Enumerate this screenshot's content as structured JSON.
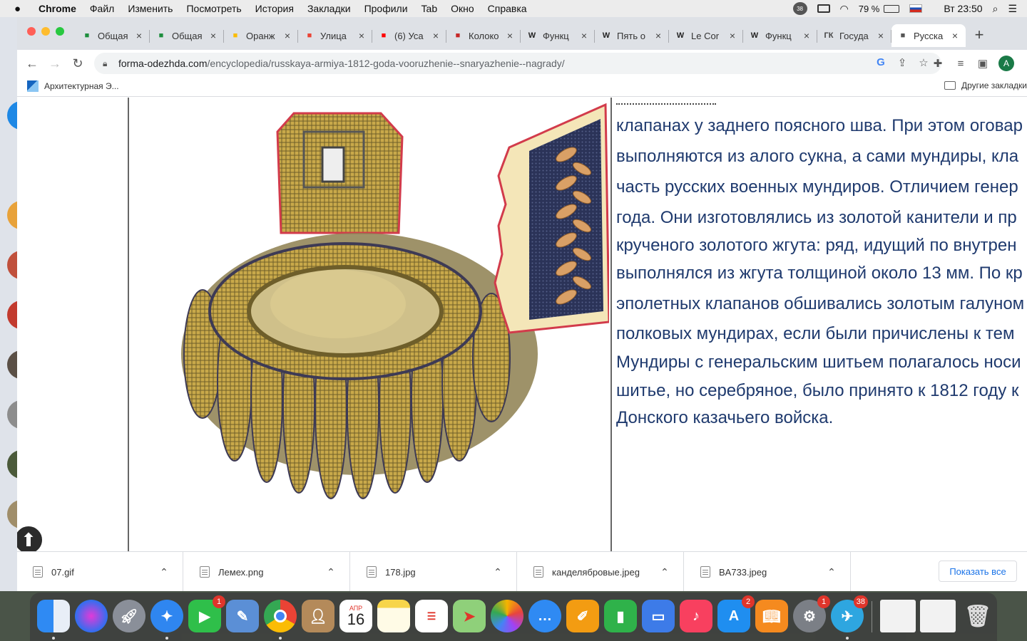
{
  "menubar": {
    "app": "Chrome",
    "items": [
      "Файл",
      "Изменить",
      "Посмотреть",
      "История",
      "Закладки",
      "Профили",
      "Tab",
      "Окно",
      "Справка"
    ],
    "battery": "79 %",
    "clock": "Вт 23:50",
    "notifications_badge": "38"
  },
  "tabs": [
    {
      "title": "Общая",
      "icon": "sheets-icon",
      "color": "#1e8e3e"
    },
    {
      "title": "Общая",
      "icon": "sheets-icon",
      "color": "#1e8e3e"
    },
    {
      "title": "Оранж",
      "icon": "drive-icon",
      "color": "#fbbc04"
    },
    {
      "title": "Улица",
      "icon": "maps-pin-icon",
      "color": "#ea4335"
    },
    {
      "title": "(6) Уса",
      "icon": "youtube-icon",
      "color": "#ff0000"
    },
    {
      "title": "Колоко",
      "icon": "star-icon",
      "color": "#c62828"
    },
    {
      "title": "Функц",
      "icon": "wikipedia-icon",
      "color": "#222222"
    },
    {
      "title": "Пять о",
      "icon": "wikipedia-icon",
      "color": "#222222"
    },
    {
      "title": "Le Cor",
      "icon": "wikipedia-icon",
      "color": "#222222"
    },
    {
      "title": "Функц",
      "icon": "wikipedia-icon",
      "color": "#222222"
    },
    {
      "title": "Госуда",
      "icon": "gk-icon",
      "color": "#444444",
      "glyph": "ГК"
    },
    {
      "title": "Русска",
      "icon": "site-icon",
      "color": "#555555",
      "active": true
    }
  ],
  "address": {
    "domain": "forma-odezhda.com",
    "path": "/encyclopedia/russkaya-armiya-1812-goda-vooruzhenie--snaryazhenie--nagrady/"
  },
  "bookmarks": {
    "first": "Архитектурная Э...",
    "other": "Другие закладки"
  },
  "article": {
    "lines": [
      "клапанах у заднего поясного шва. При этом оговар",
      "выполняются из алого сукна, а сами мундиры, кла",
      "часть русских военных мундиров. Отличием генер",
      "года. Они изготовлялись из золотой канители и пр",
      "крученого золотого жгута: ряд, идущий по внутрен",
      "выполнялся из жгута толщиной около 13 мм. По кр",
      "эполетных клапанов обшивались золотым галуном",
      "полковых мундирах, если были причислены к тем",
      "Мундиры с генеральским шитьем полагалось носи",
      "шитье, но серебряное, было принято к 1812 году к",
      "Донского казачьего войска."
    ]
  },
  "downloads": {
    "files": [
      "07.gif",
      "Лемех.png",
      "178.jpg",
      "канделябровые.jpeg",
      "BA733.jpeg"
    ],
    "show_all": "Показать все"
  },
  "dock": {
    "calendar_month": "АПР",
    "calendar_day": "16",
    "badges": {
      "facetime": "1",
      "appstore": "2",
      "settings": "1",
      "telegram": "38"
    }
  }
}
